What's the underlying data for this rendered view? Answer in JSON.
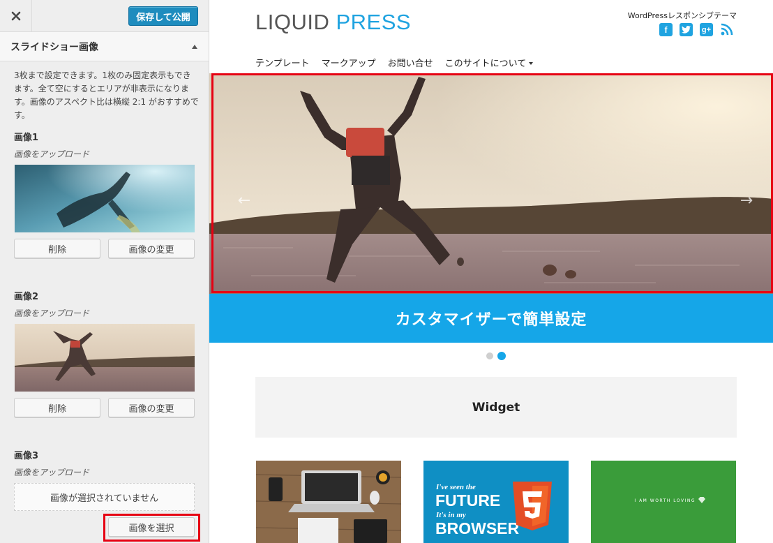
{
  "customizer": {
    "save_label": "保存して公開",
    "section_title": "スライドショー画像",
    "description": "3枚まで設定できます。1枚のみ固定表示もできます。全て空にするとエリアが非表示になります。画像のアスペクト比は横縦 2:1 がおすすめです。",
    "images": [
      {
        "label": "画像1",
        "upload_label": "画像をアップロード",
        "remove_label": "削除",
        "change_label": "画像の変更"
      },
      {
        "label": "画像2",
        "upload_label": "画像をアップロード",
        "remove_label": "削除",
        "change_label": "画像の変更"
      },
      {
        "label": "画像3",
        "upload_label": "画像をアップロード",
        "placeholder": "画像が選択されていません",
        "select_label": "画像を選択"
      }
    ]
  },
  "site": {
    "logo_part1": "LIQUID",
    "logo_part2": "PRESS",
    "tagline": "WordPressレスポンシブテーマ",
    "social_icons": [
      "facebook-icon",
      "twitter-icon",
      "google-plus-icon",
      "rss-icon"
    ],
    "nav": [
      "テンプレート",
      "マークアップ",
      "お問い合せ",
      "このサイトについて"
    ],
    "slide_caption": "カスタマイザーで簡単設定",
    "slide_count": 2,
    "active_slide": 2,
    "widget_title": "Widget",
    "card2_line1": "I've seen the",
    "card2_line2": "FUTURE",
    "card2_line3": "It's in my",
    "card2_line4": "BROWSER",
    "card3_text": "I AM WORTH LOVING"
  },
  "colors": {
    "accent": "#15a6e8",
    "save_button": "#1e8cbe",
    "highlight": "#e60012",
    "card_green": "#3a9c3a",
    "card_blue": "#0f8fc4"
  }
}
